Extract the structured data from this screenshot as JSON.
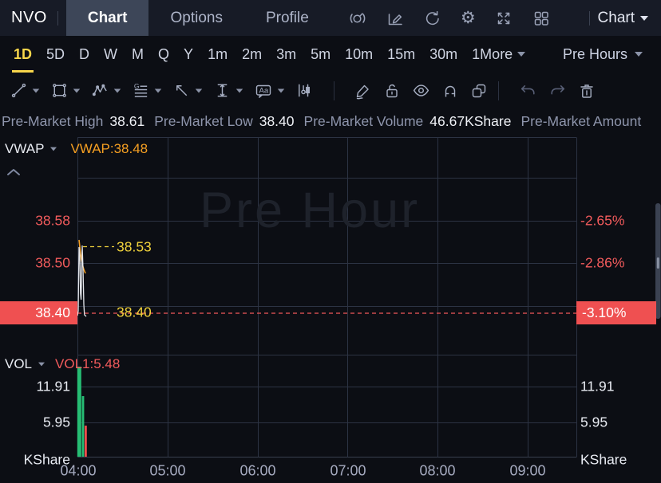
{
  "nav": {
    "symbol": "NVO",
    "tabs": [
      "Chart",
      "Options",
      "Profile"
    ],
    "active_tab": "Chart",
    "icons": [
      "gauge-icon",
      "edit-chart-icon",
      "refresh-icon",
      "settings-gear-icon",
      "fullscreen-icon",
      "layout-grid-icon"
    ],
    "layout_selector": "Chart"
  },
  "timeframe_bar": {
    "items": [
      "1D",
      "5D",
      "D",
      "W",
      "M",
      "Q",
      "Y",
      "1m",
      "2m",
      "3m",
      "5m",
      "10m",
      "15m",
      "30m",
      "1More"
    ],
    "active": "1D",
    "session": "Pre Hours"
  },
  "drawing_toolbar": {
    "tool_icons": [
      "trend-line-tool",
      "shape-tool",
      "wave-tool",
      "gann-lines-tool",
      "arrow-tool",
      "measure-tool",
      "text-annotation-tool",
      "candle-pattern-tool"
    ],
    "mode_icons": [
      "free-draw-pencil",
      "unlock",
      "visibility-eye",
      "magnet",
      "clone"
    ],
    "history_icons": [
      "undo",
      "redo",
      "delete-trash"
    ]
  },
  "stats_bar": {
    "items": [
      {
        "label": "Pre-Market High",
        "value": "38.61"
      },
      {
        "label": "Pre-Market Low",
        "value": "38.40"
      },
      {
        "label": "Pre-Market Volume",
        "value": "46.67KShare"
      },
      {
        "label": "Pre-Market Amount",
        "value": ""
      }
    ]
  },
  "price_panel": {
    "indicator": "VWAP",
    "indicator_value": "VWAP:38.48",
    "axis_left": [
      "38.58",
      "38.50"
    ],
    "current_price": "38.40",
    "axis_right": [
      "-2.65%",
      "-2.86%"
    ],
    "current_pct": "-3.10%",
    "level_high": "38.53",
    "level_last": "38.40",
    "watermark": "Pre Hour"
  },
  "volume_panel": {
    "indicator": "VOL",
    "indicator_value": "VOL1:5.48",
    "axis": [
      "11.91",
      "5.95"
    ],
    "unit": "KShare"
  },
  "time_axis": [
    "04:00",
    "05:00",
    "06:00",
    "07:00",
    "08:00",
    "09:00"
  ],
  "colors": {
    "accent_yellow": "#f8d64b",
    "vwap_orange": "#f59f22",
    "down_red": "#f25b5c",
    "current_price_bg": "#ef5051",
    "up_green": "#26bd74",
    "grid": "#2c3343"
  },
  "chart_data": {
    "type": "line",
    "session": "Pre-Market",
    "x_axis": {
      "labels": [
        "04:00",
        "05:00",
        "06:00",
        "07:00",
        "08:00",
        "09:00"
      ],
      "range": [
        "04:00",
        "09:30"
      ]
    },
    "price_panel": {
      "indicator": "VWAP",
      "vwap_current": 38.48,
      "left_axis_ticks": [
        38.58,
        38.5
      ],
      "right_axis_ticks_pct": [
        -2.65,
        -2.86
      ],
      "last_price": 38.4,
      "last_change_pct": -3.1,
      "dashed_level_high": 38.53,
      "dashed_level_last": 38.4,
      "pre_market_high": 38.61,
      "pre_market_low": 38.4,
      "price_points": [
        {
          "time": "04:00",
          "price": 38.4
        },
        {
          "time": "04:01",
          "price": 38.53
        },
        {
          "time": "04:02",
          "price": 38.44
        },
        {
          "time": "04:03",
          "price": 38.53
        },
        {
          "time": "04:04",
          "price": 38.41
        },
        {
          "time": "04:05",
          "price": 38.4
        }
      ],
      "vwap_points": [
        {
          "time": "04:00",
          "vwap": 38.53
        },
        {
          "time": "04:05",
          "vwap": 38.48
        }
      ]
    },
    "volume_panel": {
      "indicator": "VOL",
      "vol1_current": 5.48,
      "axis_ticks": [
        11.91,
        5.95
      ],
      "unit": "KShare",
      "bars": [
        {
          "time": "04:00",
          "volume": 15.0,
          "direction": "up"
        },
        {
          "time": "04:02",
          "volume": 10.2,
          "direction": "up"
        },
        {
          "time": "04:04",
          "volume": 5.48,
          "direction": "down"
        }
      ]
    }
  }
}
